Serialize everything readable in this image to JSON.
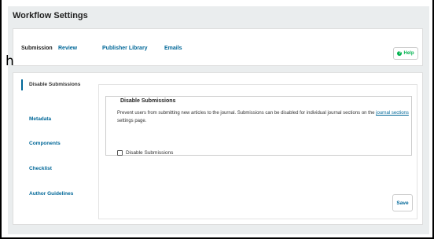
{
  "page": {
    "title": "Workflow Settings"
  },
  "stray_text": "h",
  "tabs": [
    {
      "label": "Submission",
      "active": true
    },
    {
      "label": "Review",
      "active": false
    },
    {
      "label": "Publisher Library",
      "active": false
    },
    {
      "label": "Emails",
      "active": false
    }
  ],
  "help": {
    "label": "Help",
    "icon": "help-circle-icon",
    "icon_glyph": "?"
  },
  "sidebar": {
    "items": [
      {
        "label": "Disable Submissions",
        "active": true
      },
      {
        "label": "Metadata",
        "active": false
      },
      {
        "label": "Components",
        "active": false
      },
      {
        "label": "Checklist",
        "active": false
      },
      {
        "label": "Author Guidelines",
        "active": false
      }
    ]
  },
  "section": {
    "legend": "Disable Submissions",
    "description_before": "Prevent users from submitting new articles to the journal. Submissions can be disabled for individual journal sections on the ",
    "description_link": "journal sections",
    "description_after": " settings page.",
    "checkbox_label": "Disable Submissions",
    "checkbox_checked": false
  },
  "actions": {
    "save_label": "Save"
  },
  "colors": {
    "link": "#006798",
    "help": "#00b24e",
    "panel_bg": "#eaedee"
  }
}
